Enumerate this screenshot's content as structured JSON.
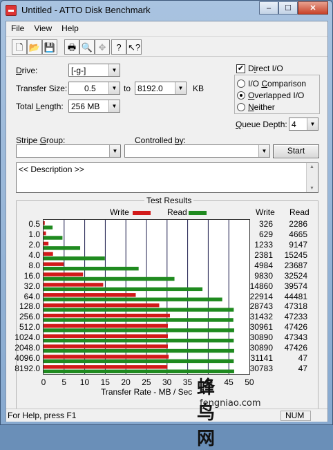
{
  "window": {
    "title": "Untitled - ATTO Disk Benchmark",
    "minimize": "–",
    "maximize": "☐",
    "close": "✕"
  },
  "menu": [
    "File",
    "View",
    "Help"
  ],
  "toolbar": [
    "new-icon",
    "open-icon",
    "save-icon",
    "print-icon",
    "print-preview-icon",
    "move-icon",
    "help-icon",
    "context-help-icon"
  ],
  "form": {
    "drive_label": "Drive:",
    "drive_value": "[-g-]",
    "transfer_size_label": "Transfer Size:",
    "transfer_from": "0.5",
    "to_label": "to",
    "transfer_to": "8192.0",
    "kb_label": "KB",
    "total_length_label": "Total Length:",
    "total_length_value": "256 MB",
    "direct_io_label": "Direct I/O",
    "direct_io_checked": true,
    "io_comparison_label": "I/O Comparison",
    "overlapped_io_label": "Overlapped I/O",
    "neither_label": "Neither",
    "selected_mode": "overlapped",
    "queue_depth_label": "Queue Depth:",
    "queue_depth_value": "4",
    "stripe_group_label": "Stripe Group:",
    "controlled_by_label": "Controlled by:",
    "start_label": "Start",
    "description": "<< Description >>"
  },
  "results": {
    "title": "Test Results",
    "write_legend": "Write",
    "read_legend": "Read",
    "write_header": "Write",
    "read_header": "Read",
    "write_color": "#d21a1a",
    "read_color": "#1f8a1f"
  },
  "chart_data": {
    "type": "bar",
    "title": "Test Results",
    "xlabel": "Transfer Rate - MB / Sec",
    "xlim": [
      0,
      50
    ],
    "xticks": [
      "0",
      "5",
      "10",
      "15",
      "20",
      "25",
      "30",
      "35",
      "40",
      "45",
      "50"
    ],
    "categories": [
      "0.5",
      "1.0",
      "2.0",
      "4.0",
      "8.0",
      "16.0",
      "32.0",
      "64.0",
      "128.0",
      "256.0",
      "512.0",
      "1024.0",
      "2048.0",
      "4096.0",
      "8192.0"
    ],
    "series": [
      {
        "name": "Write",
        "values": [
          0.3,
          0.6,
          1.2,
          2.3,
          4.9,
          9.6,
          14.5,
          22.4,
          28.1,
          30.7,
          30.2,
          30.2,
          30.2,
          30.4,
          30.1
        ]
      },
      {
        "name": "Read",
        "values": [
          2.2,
          4.6,
          8.9,
          14.9,
          23.1,
          31.8,
          38.6,
          43.4,
          46.2,
          46.1,
          46.3,
          46.2,
          46.3,
          46.2,
          46.3
        ]
      }
    ],
    "write_values": [
      "326",
      "629",
      "1233",
      "2381",
      "4984",
      "9830",
      "14860",
      "22914",
      "28743",
      "31432",
      "30961",
      "30890",
      "30890",
      "31141",
      "30783"
    ],
    "read_values": [
      "2286",
      "4665",
      "9147",
      "15245",
      "23687",
      "32524",
      "39574",
      "44481",
      "47318",
      "47233",
      "47426",
      "47343",
      "47426",
      "47",
      "47"
    ]
  },
  "status": {
    "text": "For Help, press F1",
    "num": "NUM"
  },
  "watermark": {
    "cn": "蜂鸟网",
    "en": "fengniao.com"
  }
}
